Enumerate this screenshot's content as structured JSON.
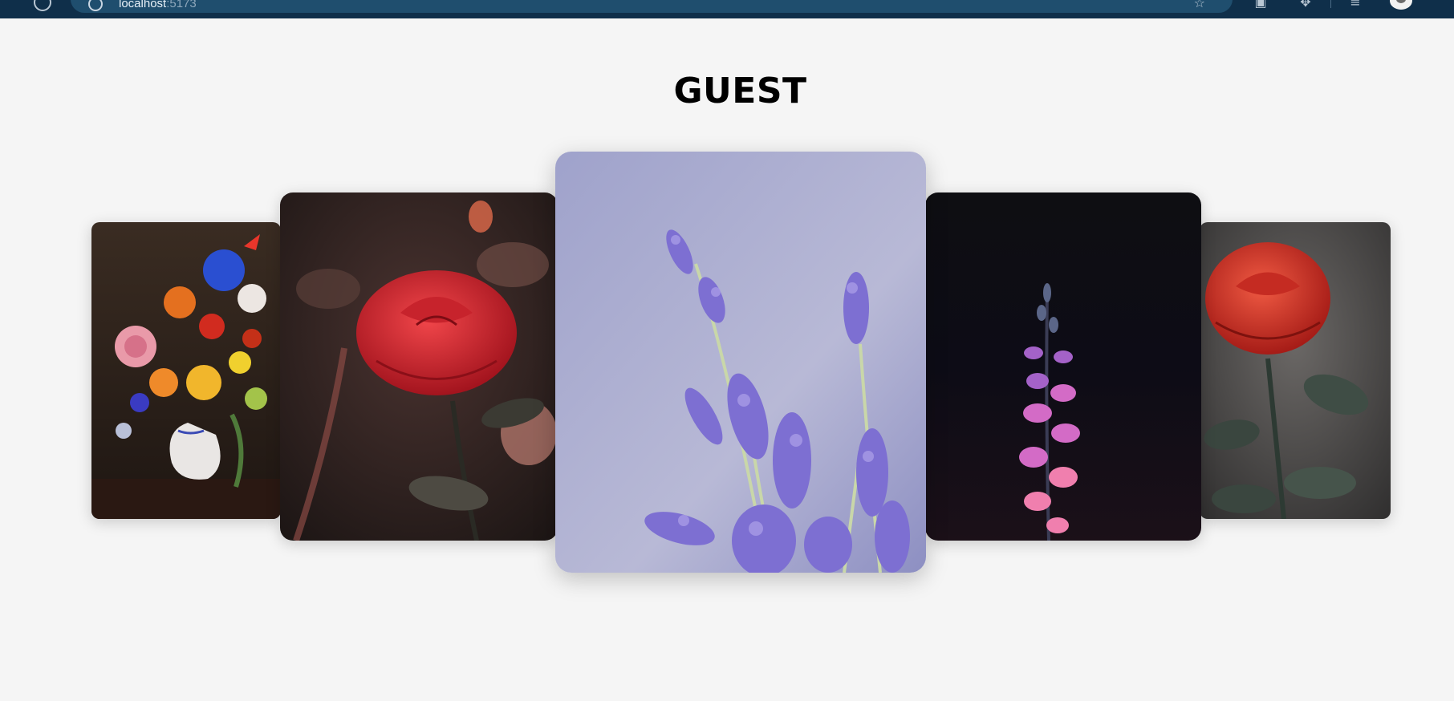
{
  "browser": {
    "url_host": "localhost",
    "url_port": ":5173",
    "icons": [
      "reload-icon",
      "info-icon",
      "star-icon",
      "extension-icon",
      "puzzle-icon",
      "reading-list-icon",
      "profile-avatar"
    ]
  },
  "page": {
    "title": "GUEST"
  },
  "carousel": {
    "slides": [
      {
        "subject": "flower-vase-bouquet"
      },
      {
        "subject": "red-rose-dark"
      },
      {
        "subject": "lavender"
      },
      {
        "subject": "pink-flower-dark"
      },
      {
        "subject": "red-rose-dew"
      }
    ],
    "active_index": 2
  },
  "colors": {
    "background": "#f5f5f5",
    "browser_bar": "#0f2f4a"
  }
}
